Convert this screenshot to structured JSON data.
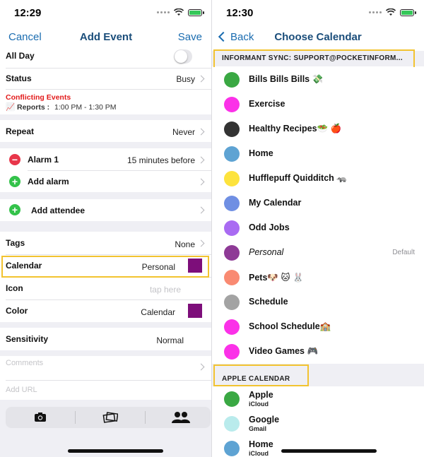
{
  "left": {
    "status_time": "12:29",
    "nav": {
      "cancel": "Cancel",
      "title": "Add Event",
      "save": "Save"
    },
    "all_day_label": "All Day",
    "all_day_on": false,
    "status": {
      "label": "Status",
      "value": "Busy"
    },
    "conflicts": {
      "heading": "Conflicting Events",
      "line_prefix": "📈 Reports :",
      "line_time": "1:00 PM - 1:30 PM"
    },
    "repeat": {
      "label": "Repeat",
      "value": "Never"
    },
    "alarm1": {
      "label": "Alarm 1",
      "value": "15 minutes before"
    },
    "add_alarm": "Add alarm",
    "add_attendee": "Add attendee",
    "tags": {
      "label": "Tags",
      "value": "None"
    },
    "calendar": {
      "label": "Calendar",
      "value": "Personal",
      "swatch_color": "#7d0e7a"
    },
    "icon": {
      "label": "Icon",
      "placeholder": "tap here"
    },
    "color": {
      "label": "Color",
      "value": "Calendar",
      "swatch_color": "#7d0e7a"
    },
    "sensitivity": {
      "label": "Sensitivity",
      "value": "Normal"
    },
    "comments_placeholder": "Comments",
    "url_placeholder": "Add URL",
    "toolbar_icons": [
      "camera-icon",
      "photos-icon",
      "contacts-icon"
    ]
  },
  "right": {
    "status_time": "12:30",
    "nav": {
      "back": "Back",
      "title": "Choose Calendar"
    },
    "section1": "INFORMANT SYNC: SUPPORT@POCKETINFORM...",
    "calendars": [
      {
        "name": "Bills Bills Bills 💸",
        "color": "#3aa843"
      },
      {
        "name": "Exercise",
        "color": "#fb31e8"
      },
      {
        "name": "Healthy Recipes🥗 🍎",
        "color": "#333333"
      },
      {
        "name": "Home",
        "color": "#5ea3d3"
      },
      {
        "name": "Hufflepuff Quidditch 🦡",
        "color": "#fde33d"
      },
      {
        "name": "My Calendar",
        "color": "#6f8fe3"
      },
      {
        "name": "Odd Jobs",
        "color": "#a96bf2"
      },
      {
        "name": "Personal",
        "color": "#8e3a96",
        "italic": true,
        "badge": "Default"
      },
      {
        "name": "Pets🐶 🐱 🐰",
        "color": "#f98a72"
      },
      {
        "name": "Schedule",
        "color": "#a3a3a3"
      },
      {
        "name": "School Schedule🏫",
        "color": "#fb31e8"
      },
      {
        "name": "Video Games 🎮",
        "color": "#fb31e8"
      }
    ],
    "section2": "APPLE CALENDAR",
    "apple_calendars": [
      {
        "name": "Apple",
        "sub": "iCloud",
        "color": "#3aa843"
      },
      {
        "name": "Google",
        "sub": "Gmail",
        "color": "#b9ebec"
      },
      {
        "name": "Home",
        "sub": "iCloud",
        "color": "#5ea3d3"
      }
    ]
  }
}
